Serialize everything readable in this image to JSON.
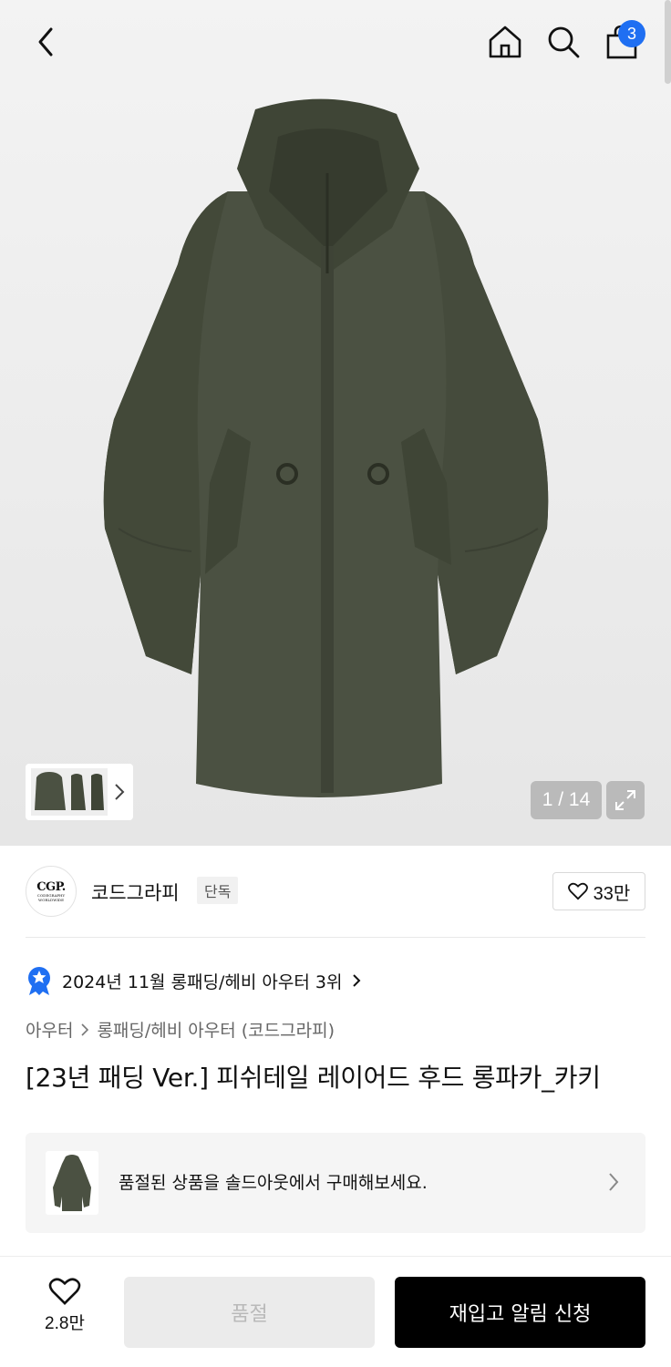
{
  "header": {
    "cart_count": "3",
    "icons": [
      "chevron-left-icon",
      "home-icon",
      "search-icon",
      "shopping-bag-icon"
    ]
  },
  "gallery": {
    "page_counter": "1 / 14",
    "thumbnail_count_shown": 3
  },
  "brand": {
    "logo_text": "CGP.",
    "logo_subtext": "CODEGRAPHY WORLDWIDE",
    "name": "코드그라피",
    "tag": "단독",
    "likes": "33만"
  },
  "ranking": {
    "text": "2024년 11월 롱패딩/헤비 아우터 3위",
    "badge_color": "#1f6ff2"
  },
  "breadcrumb": {
    "level1": "아우터",
    "level2": "롱패딩/헤비 아우터 (코드그라피)"
  },
  "product": {
    "title": "[23년 패딩 Ver.] 피쉬테일 레이어드 후드 롱파카_카키",
    "color": "#4b5142"
  },
  "soldout_banner": {
    "text": "품절된 상품을 솔드아웃에서 구매해보세요."
  },
  "bottom_bar": {
    "like_count": "2.8만",
    "soldout_label": "품절",
    "restock_label": "재입고 알림 신청"
  }
}
